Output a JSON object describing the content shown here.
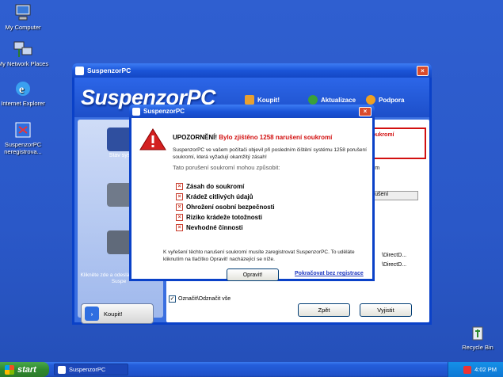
{
  "desktop": {
    "icons": [
      {
        "label": "My Computer"
      },
      {
        "label": "My Network Places"
      },
      {
        "label": "Internet Explorer"
      },
      {
        "label": "SuspenzorPC neregistrova..."
      },
      {
        "label": "Recycle Bin"
      }
    ]
  },
  "main_window": {
    "title": "SuspenzorPC",
    "brand": "SuspenzorPC",
    "top_links": {
      "buy": "Koupit!",
      "update": "Aktualizace",
      "support": "Podpora"
    },
    "left_panel": {
      "item1": "Stav syst",
      "click_text": "Klikněte zde a odeslání programu Suspe",
      "buy_button": "Koupit!"
    },
    "right_panel": {
      "alert_text": "soukromí",
      "col_header": "narušení",
      "list_text": "chem",
      "paths": [
        "\\DirectD...",
        "\\DirectD..."
      ],
      "check_all": "Označit\\Odznačit vše",
      "fix_button": "Zpět",
      "exit_button": "Vyjistit"
    }
  },
  "dialog": {
    "title": "SuspenzorPC",
    "heading_prefix": "UPOZORNĚNÍ!",
    "heading_red": "Bylo zjištěno 1258 narušení soukromí",
    "text": "SuspenzorPC ve vašem počítači objevil při posledním čištění systému 1258 porušení soukromí, která vyžadují okamžitý zásah!",
    "subheading": "Tato porušení soukromí mohou způsobit:",
    "threats": [
      "Zásah do soukromí",
      "Krádež citlivých údajů",
      "Ohrožení osobní bezpečnosti",
      "Riziko krádeže totožnosti",
      "Nevhodné činnosti"
    ],
    "footer": "K vyřešení těchto narušení soukromí musíte zaregistrovat SuspenzorPC. To uděláte kliknutím na tlačítko Opravit! nacházející se níže.",
    "repair_button": "Opravit!",
    "continue_link": "Pokračovat bez registrace"
  },
  "taskbar": {
    "start": "start",
    "task": "SuspenzorPC",
    "time": "4:02 PM"
  }
}
